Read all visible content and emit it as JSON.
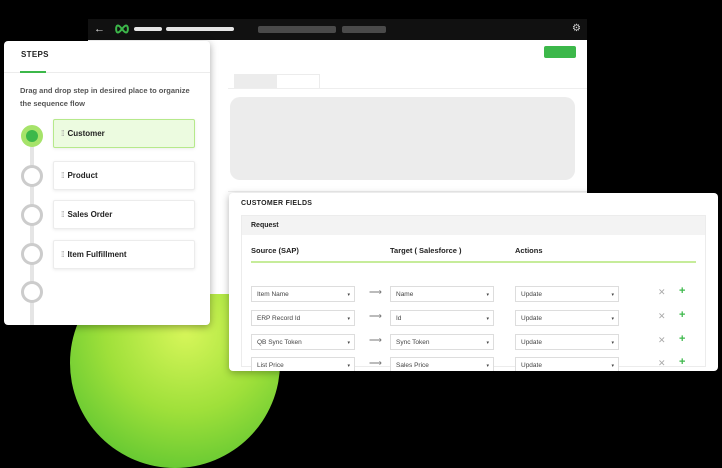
{
  "colors": {
    "accent": "#3cb84a",
    "active_step_bg": "#ecfbe0",
    "backdrop": "#000000"
  },
  "icons": {
    "back": "arrow-left",
    "logo": "infinity-logo",
    "settings": "gear",
    "drag": "drag-handle",
    "map_arrow": "long-arrow-right",
    "remove": "close-x",
    "add": "plus"
  },
  "steps_panel": {
    "title": "STEPS",
    "hint": "Drag and drop step in desired place to organize the sequence flow",
    "steps": [
      {
        "label": "Customer",
        "active": true
      },
      {
        "label": "Product",
        "active": false
      },
      {
        "label": "Sales Order",
        "active": false
      },
      {
        "label": "Item Fulfillment",
        "active": false
      }
    ]
  },
  "fields_panel": {
    "title": "CUSTOMER FIELDS",
    "section": "Request",
    "columns": {
      "source": "Source (SAP)",
      "target": "Target ( Salesforce )",
      "actions": "Actions"
    },
    "rows": [
      {
        "source": "Item Name",
        "target": "Name",
        "action": "Update"
      },
      {
        "source": "ERP Record Id",
        "target": "Id",
        "action": "Update"
      },
      {
        "source": "QB Sync Token",
        "target": "Sync Token",
        "action": "Update"
      },
      {
        "source": "List Price",
        "target": "Sales Price",
        "action": "Update"
      }
    ],
    "chevron": "▾",
    "arrow_glyph": "⟶",
    "remove_glyph": "✕",
    "add_glyph": "+"
  }
}
